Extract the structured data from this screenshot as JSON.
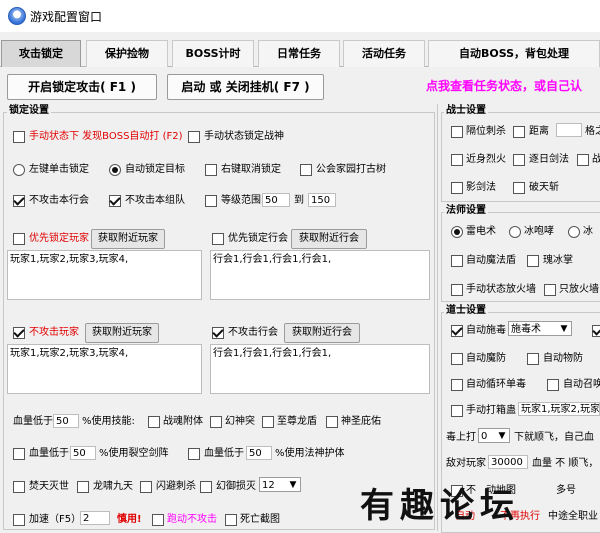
{
  "window": {
    "title": "游戏配置窗口"
  },
  "tabs": [
    {
      "label": "攻击锁定",
      "active": true
    },
    {
      "label": "保护捡物",
      "active": false
    },
    {
      "label": "BOSS计时",
      "active": false
    },
    {
      "label": "日常任务",
      "active": false
    },
    {
      "label": "活动任务",
      "active": false
    },
    {
      "label": "自动BOSS，背包处理",
      "active": false
    }
  ],
  "toolbar": {
    "start_lock": "开启锁定攻击( F1 )",
    "toggle_hang": "启动 或 关闭挂机( F7 )",
    "notice": "点我查看任务状态，或自己认"
  },
  "lock": {
    "title": "锁定设置",
    "manual_boss": "手动状态下 发现BOSS自动打 (F2)",
    "manual_god": "手动状态锁定战神",
    "left_click": "左键单击锁定",
    "auto_target": "自动锁定目标",
    "right_click": "右键取消锁定",
    "guild_tree": "公会家园打古树",
    "no_guild": "不攻击本行会",
    "no_team": "不攻击本组队",
    "level_range": "等级范围",
    "level_min": "50",
    "level_to": "到",
    "level_max": "150",
    "prio_player": "优先锁定玩家",
    "get_players": "获取附近玩家",
    "prio_guild": "优先锁定行会",
    "get_guilds": "获取附近行会",
    "players_text": "玩家1,玩家2,玩家3,玩家4,",
    "guilds_text": "行会1,行会1,行会1,行会1,",
    "no_player": "不攻击玩家",
    "get_players2": "获取附近玩家",
    "no_guild2": "不攻击行会",
    "get_guilds2": "获取附近行会",
    "players_text2": "玩家1,玩家2,玩家3,玩家4,",
    "guilds_text2": "行会1,行会1,行会1,行会1,"
  },
  "skills": {
    "hp_below": "血量低于",
    "hp1": "50",
    "pct_use": "%使用技能:",
    "s1": "战魂附体",
    "s2": "幻神突",
    "s3": "至尊龙盾",
    "s4": "神圣庇佑",
    "hp2_label": "血量低于",
    "hp2": "50",
    "hp2_skill": "%使用裂空剑阵",
    "hp3_label": "血量低于",
    "hp3": "50",
    "hp3_skill": "%使用法神护体",
    "b1": "焚天灭世",
    "b2": "龙啸九天",
    "b3": "闪避刺杀",
    "b4": "幻御损灭",
    "b4_value": "12",
    "speed_label": "加速（F5）",
    "speed_value": "2",
    "speed_warn": "慎用!",
    "run_no_attack": "跑动不攻击",
    "death_shot": "死亡截图"
  },
  "warrior": {
    "title": "战士设置",
    "c1": "隔位刺杀",
    "c2": "距离",
    "c2_suffix": "格之",
    "c3": "近身烈火",
    "c4": "逐日剑法",
    "c4_suffix": "战",
    "c5": "影剑法",
    "c6": "破天斩"
  },
  "mage": {
    "title": "法师设置",
    "r1": "雷电术",
    "r2": "冰咆哮",
    "r3": "冰",
    "c1": "自动魔法盾",
    "c2": "瑰冰掌",
    "c3": "手动状态放火墙",
    "c4": "只放火墙"
  },
  "taoist": {
    "title": "道士设置",
    "auto_poison": "自动施毒",
    "poison_select": "施毒术",
    "c2": "自动魔防",
    "c3": "自动物防",
    "c4": "自动循环单毒",
    "c5": "自动召唤",
    "c6": "手动打箱蛊",
    "c6_text": "玩家1,玩家2,玩家3",
    "poison_limit": "毒上打",
    "poison_limit_value": "0",
    "poison_limit_text": "下就顺飞，自己血",
    "enemy_label": "敌对玩家",
    "enemy_value": "30000",
    "enemy_text": "血量 不 顺飞，",
    "c7": "不",
    "c7_text": "动地图",
    "c7_suffix": "多号",
    "bottom_note": "自动",
    "bottom_note2": "不再执行",
    "bottom_note3": "中途全职业"
  },
  "watermark": "有趣论坛"
}
